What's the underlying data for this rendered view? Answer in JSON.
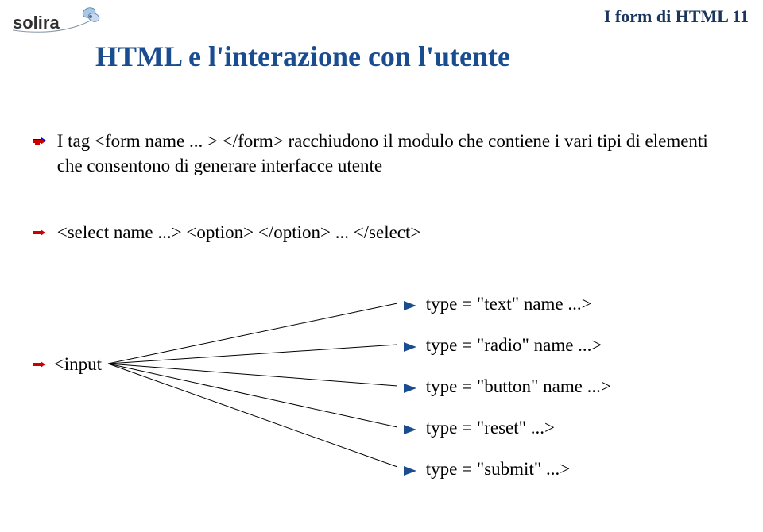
{
  "header": {
    "text": "I form di HTML 11"
  },
  "logo": {
    "text": "solira"
  },
  "title": "HTML e l'interazione con l'utente",
  "bullets": {
    "b1": "I tag <form name ... > </form> racchiudono il modulo che contiene i vari tipi di elementi che consentono di generare interfacce utente",
    "b2": "<select name ...> <option> </option> ... </select>"
  },
  "input_label": "<input",
  "types": {
    "t1": "type = \"text\" name ...>",
    "t2": "type = \"radio\" name ...>",
    "t3": "type = \"button\" name ...>",
    "t4": "type = \"reset\" ...>",
    "t5": "type = \"submit\" ...>"
  }
}
